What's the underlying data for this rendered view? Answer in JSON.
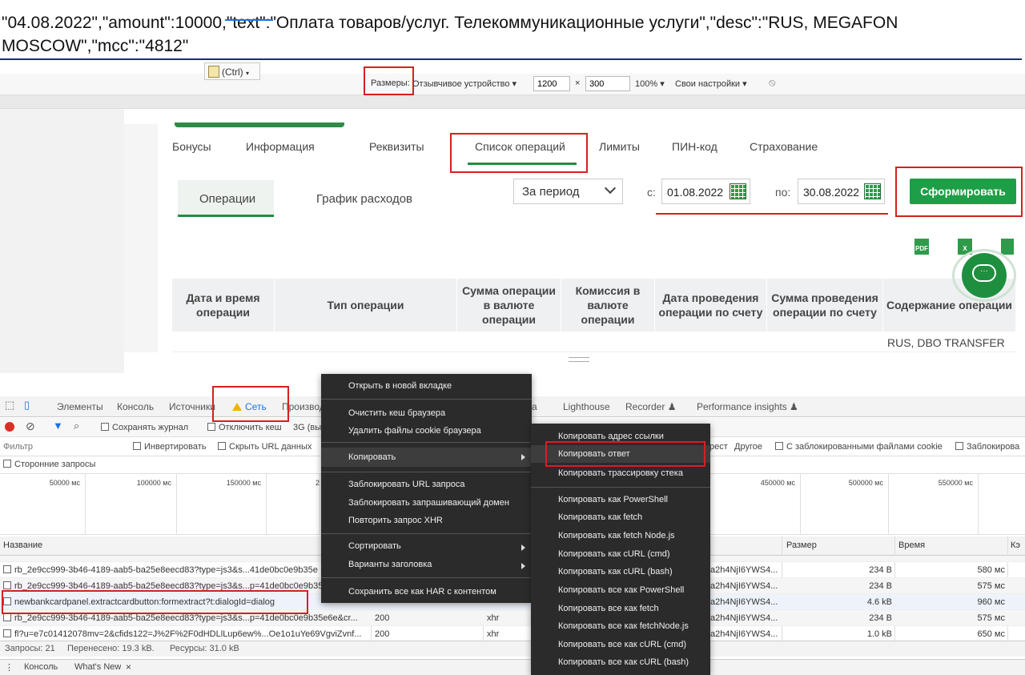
{
  "doc": {
    "text": "\"04.08.2022\",\"amount\":10000,\"text\":\"Оплата товаров/услуг. Телекоммуникационные услуги\",\"desc\":\"RUS, MEGAFON MOSCOW\",\"mcc\":\"4812\""
  },
  "device_toolbar": {
    "ctrl": "(Ctrl)",
    "sizes_label": "Размеры:",
    "device": "Отзывчивое устройство ▾",
    "width": "1200",
    "times": "×",
    "height": "300",
    "zoom": "100% ▾",
    "settings": "Свои настройки ▾",
    "rotate": "⦸"
  },
  "page": {
    "nav_tabs": [
      "Бонусы",
      "Информация",
      "Реквизиты",
      "Список операций",
      "Лимиты",
      "ПИН-код",
      "Страхование"
    ],
    "sub_tabs": [
      "Операции",
      "График расходов"
    ],
    "period": "За период",
    "from_label": "с:",
    "from_date": "01.08.2022",
    "to_label": "по:",
    "to_date": "30.08.2022",
    "form_button": "Сформировать",
    "download_icons": [
      "PDF",
      "X"
    ],
    "table_headers": [
      "Дата и время операции",
      "Тип операции",
      "Сумма операции в валюте операции",
      "Комиссия в валюте операции",
      "Дата проведения операции по счету",
      "Сумма проведения операции по счету",
      "Содержание операции"
    ],
    "table_cell": "RUS, DBO TRANSFER"
  },
  "devtools": {
    "tabs": [
      "Элементы",
      "Консоль",
      "Источники",
      "Сеть",
      "Производ",
      "a",
      "Lighthouse",
      "Recorder ♟",
      "Performance insights ♟"
    ],
    "toolbar": {
      "preserve_log": "Сохранять журнал",
      "disable_cache": "Отключить кеш",
      "throttle": "3G (вы"
    },
    "filter": {
      "placeholder": "Фильтр",
      "invert": "Инвертировать",
      "hide_urls": "Скрыть URL данных",
      "fragment": "рест",
      "other": "Другое",
      "blocked_cookies": "С заблокированными файлами cookie",
      "blocked": "Заблокирова"
    },
    "third_party": "Сторонние запросы",
    "timeline": [
      "50000 мс",
      "100000 мс",
      "150000 мс",
      "2",
      "450000 мс",
      "500000 мс",
      "550000 мс"
    ],
    "columns": {
      "name": "Название",
      "size": "Размер",
      "time": "Время",
      "cache": "Кэ"
    },
    "rows": [
      {
        "name": "rb_2e9cc999-3b46-4189-aab5-ba25e8eecd83?type=js3&s...41de0bc0e9b35e",
        "status": "",
        "type": "",
        "initiator": "a2h4NjI6YWS4...",
        "size": "234 B",
        "time": "580 мс"
      },
      {
        "name": "rb_2e9cc999-3b46-4189-aab5-ba25e8eecd83?type=js3&s...p=41de0bc0e9b35e",
        "status": "",
        "type": "",
        "initiator": "a2h4NjI6YWS4...",
        "size": "234 B",
        "time": "575 мс"
      },
      {
        "name": "newbankcardpanel.extractcardbutton:formextract?t:dialogId=dialog",
        "status": "",
        "type": "",
        "initiator": "a2h4NjI6YWS4...",
        "size": "4.6 kB",
        "time": "960 мс"
      },
      {
        "name": "rb_2e9cc999-3b46-4189-aab5-ba25e8eecd83?type=js3&s...p=41de0bc0e9b35e6e&cr...",
        "status": "200",
        "type": "xhr",
        "initiator": "a2h4NjI6YWS4...",
        "size": "234 B",
        "time": "575 мс"
      },
      {
        "name": "fl?u=e7c01412078mv=2&cfids122=J%2F%2F0dHDLlLup6ew%...Oe1o1uYe69VgviZvnf...",
        "status": "200",
        "type": "xhr",
        "initiator": "a2h4NjI6YWS4...",
        "size": "1.0 kB",
        "time": "650 мс"
      }
    ],
    "status": {
      "requests": "Запросы: 21",
      "transferred": "Перенесено: 19.3 kB.",
      "resources": "Ресурсы: 31.0 kB"
    },
    "drawer": {
      "console": "Консоль",
      "whats_new": "What's New",
      "close": "×"
    }
  },
  "context_menu": {
    "items": [
      "Открыть в новой вкладке",
      "Очистить кеш браузера",
      "Удалить файлы cookie браузера",
      "Копировать",
      "Заблокировать URL запроса",
      "Заблокировать запрашивающий домен",
      "Повторить запрос XHR",
      "Сортировать",
      "Варианты заголовка",
      "Сохранить все как HAR с контентом"
    ]
  },
  "copy_submenu": {
    "items": [
      "Копировать адрес ссылки",
      "Копировать ответ",
      "Копировать трассировку стека",
      "Копировать как PowerShell",
      "Копировать как fetch",
      "Копировать как fetch Node.js",
      "Копировать как cURL (cmd)",
      "Копировать как cURL (bash)",
      "Копировать все как PowerShell",
      "Копировать все как fetch",
      "Копировать все как fetchNode.js",
      "Копировать все как cURL (cmd)",
      "Копировать все как cURL (bash)"
    ]
  },
  "colors": {
    "accent_green": "#1e9e46",
    "annotation_red": "#d62020",
    "menu_bg": "#2b2b2b"
  }
}
